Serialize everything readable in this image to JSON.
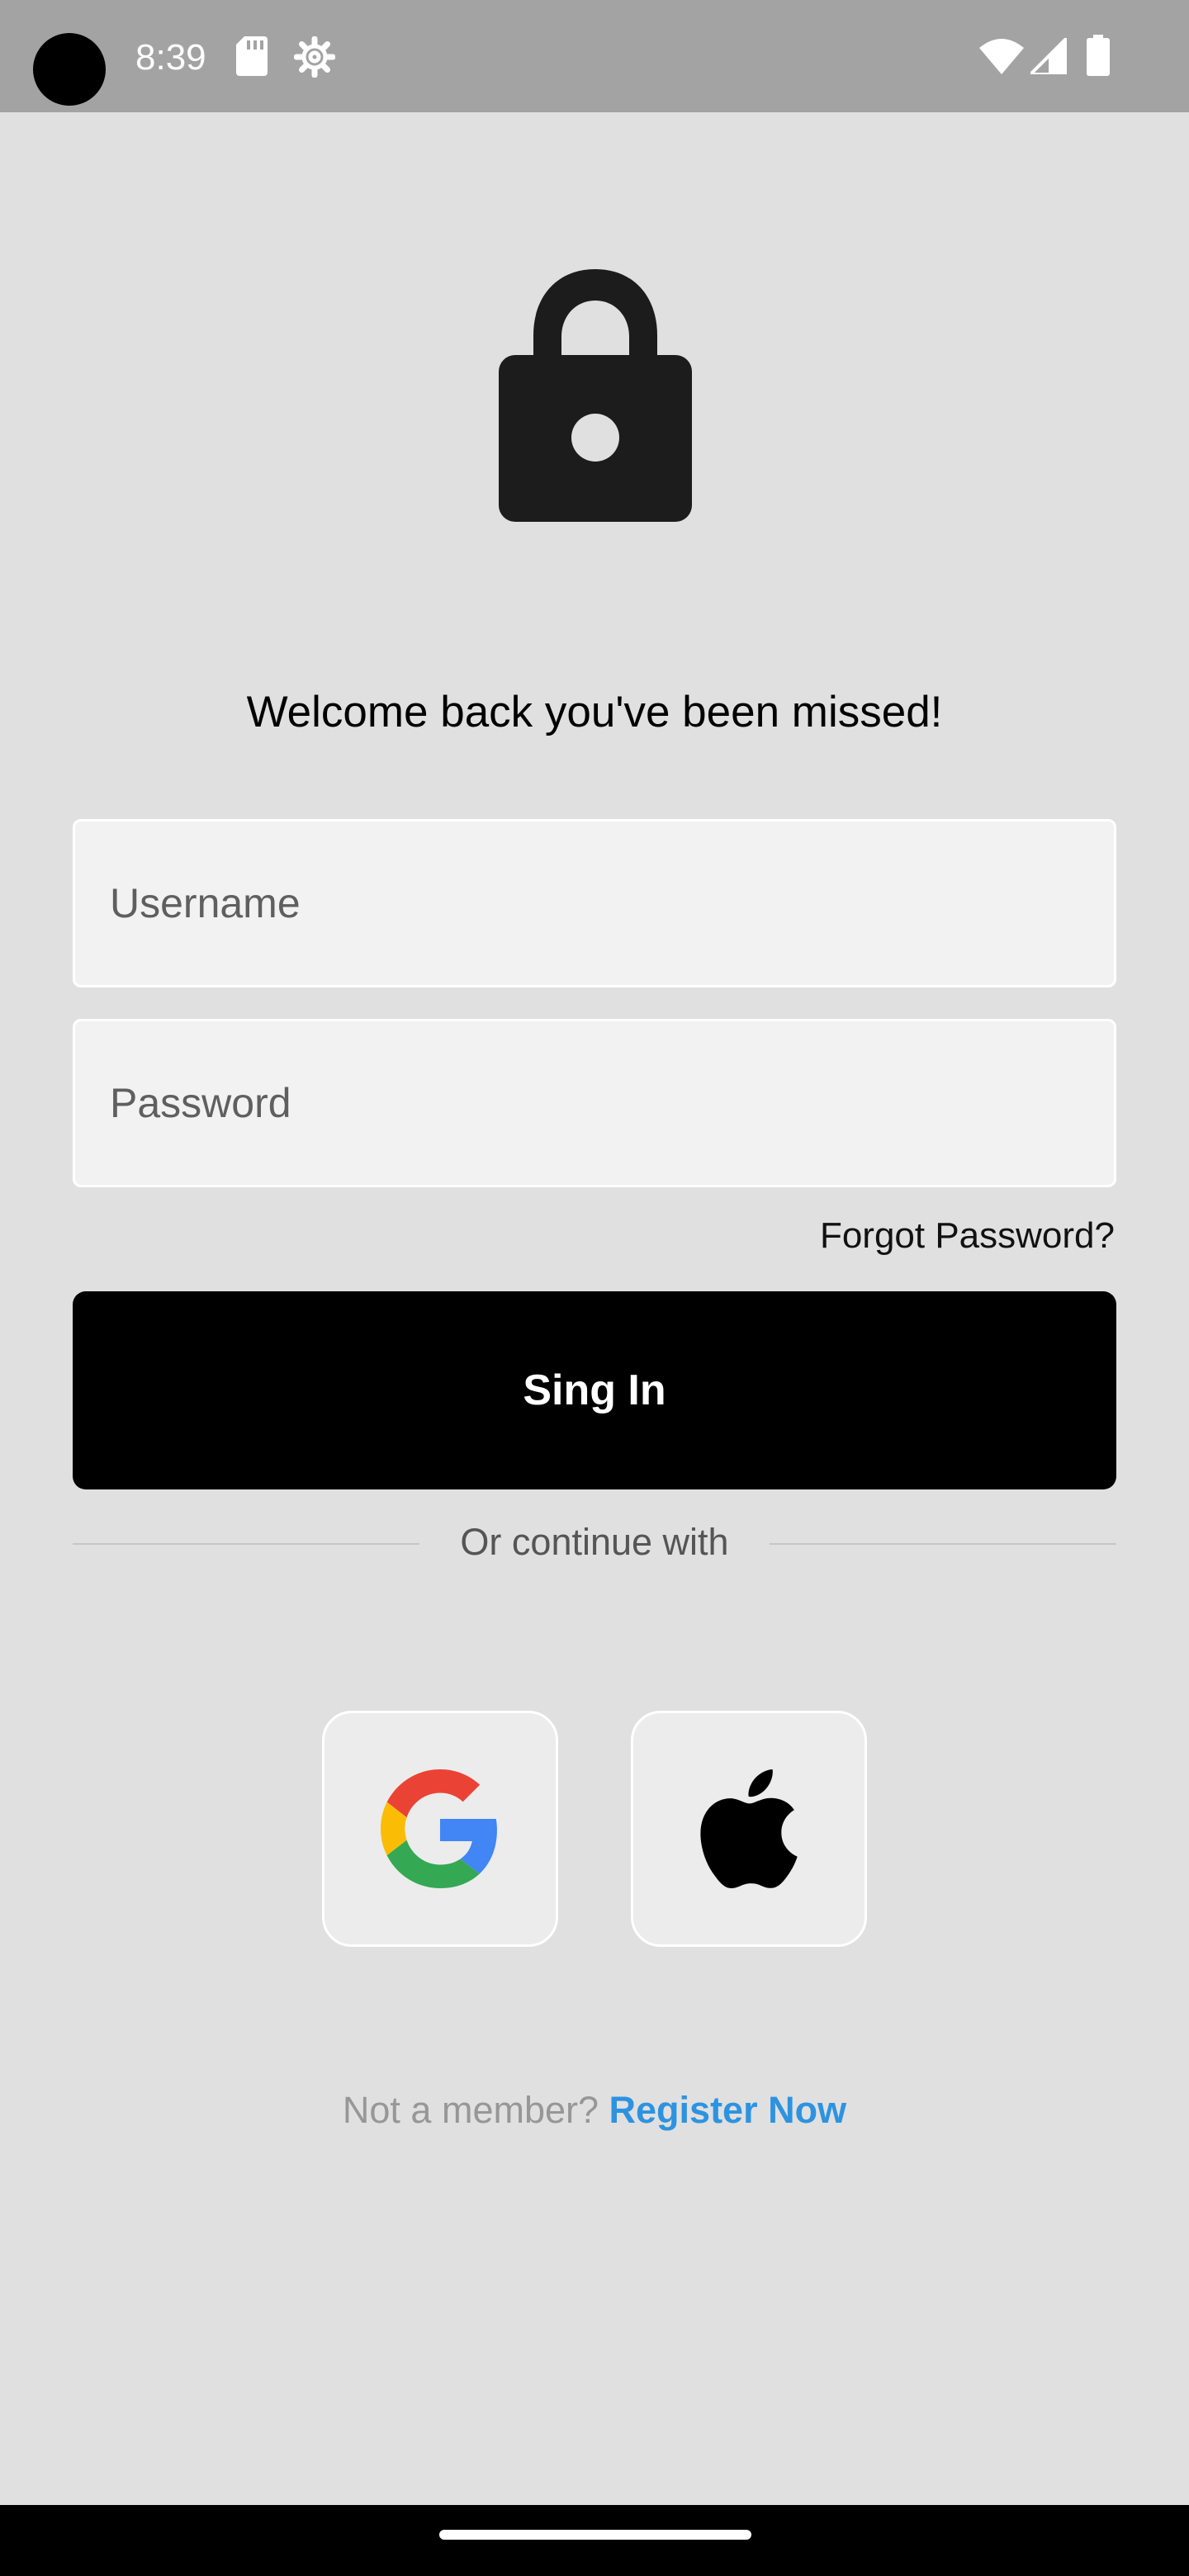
{
  "status_bar": {
    "time": "8:39",
    "icons_left": [
      "sd-card-icon",
      "settings-gear-icon"
    ],
    "icons_right": [
      "wifi-icon",
      "cell-signal-icon",
      "battery-icon"
    ]
  },
  "header": {
    "icon": "lock-icon",
    "welcome": "Welcome back you've been missed!"
  },
  "form": {
    "username_placeholder": "Username",
    "username_value": "",
    "password_placeholder": "Password",
    "password_value": "",
    "forgot_label": "Forgot Password?",
    "signin_label": "Sing In"
  },
  "divider": {
    "label": "Or continue with"
  },
  "social": [
    {
      "name": "google",
      "icon": "google-logo-icon"
    },
    {
      "name": "apple",
      "icon": "apple-logo-icon"
    }
  ],
  "footer": {
    "not_member": "Not a member?",
    "register_label": "Register Now"
  },
  "colors": {
    "background": "#e0e0e0",
    "status_bar": "#a3a3a3",
    "button": "#000000",
    "link": "#2d93e0",
    "field": "#f2f2f2"
  }
}
